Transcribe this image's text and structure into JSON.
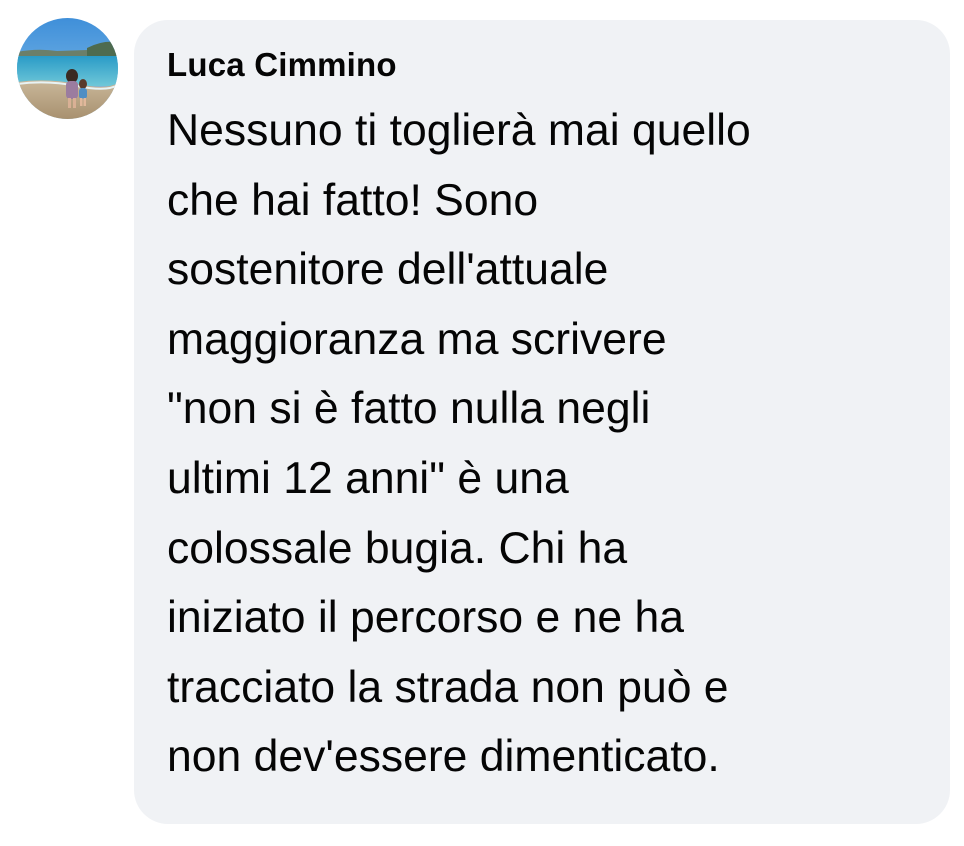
{
  "comment": {
    "author": "Luca Cimmino",
    "avatar_icon": "beach-photo-avatar",
    "lines": [
      "Nessuno ti toglierà mai quello",
      "che hai fatto! Sono",
      "sostenitore dell'attuale",
      "maggioranza ma scrivere",
      "\"non si è fatto nulla negli",
      "ultimi 12 anni\" è una",
      "colossale bugia. Chi ha",
      "iniziato il percorso e ne ha",
      "tracciato la strada non può e",
      "non dev'essere dimenticato."
    ]
  },
  "colors": {
    "bubble_background": "#f0f2f5",
    "text": "#050505",
    "page_background": "#ffffff"
  }
}
